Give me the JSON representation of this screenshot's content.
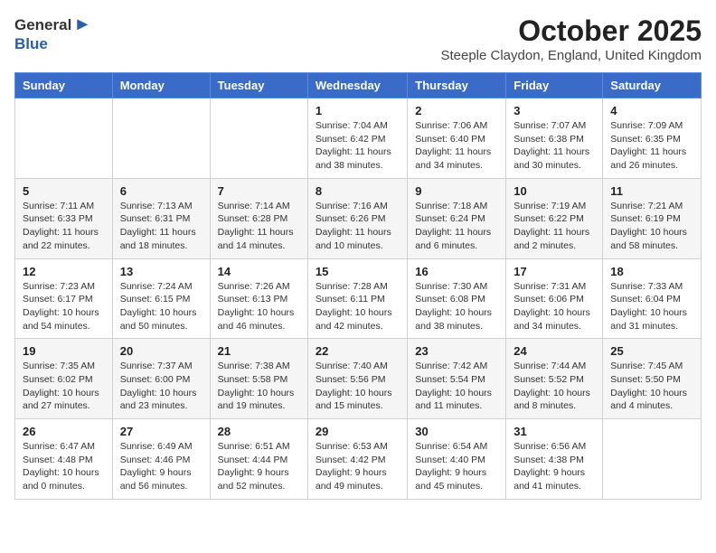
{
  "header": {
    "logo_general": "General",
    "logo_blue": "Blue",
    "month_title": "October 2025",
    "subtitle": "Steeple Claydon, England, United Kingdom"
  },
  "days_of_week": [
    "Sunday",
    "Monday",
    "Tuesday",
    "Wednesday",
    "Thursday",
    "Friday",
    "Saturday"
  ],
  "weeks": [
    [
      {
        "day": "",
        "info": ""
      },
      {
        "day": "",
        "info": ""
      },
      {
        "day": "",
        "info": ""
      },
      {
        "day": "1",
        "info": "Sunrise: 7:04 AM\nSunset: 6:42 PM\nDaylight: 11 hours and 38 minutes."
      },
      {
        "day": "2",
        "info": "Sunrise: 7:06 AM\nSunset: 6:40 PM\nDaylight: 11 hours and 34 minutes."
      },
      {
        "day": "3",
        "info": "Sunrise: 7:07 AM\nSunset: 6:38 PM\nDaylight: 11 hours and 30 minutes."
      },
      {
        "day": "4",
        "info": "Sunrise: 7:09 AM\nSunset: 6:35 PM\nDaylight: 11 hours and 26 minutes."
      }
    ],
    [
      {
        "day": "5",
        "info": "Sunrise: 7:11 AM\nSunset: 6:33 PM\nDaylight: 11 hours and 22 minutes."
      },
      {
        "day": "6",
        "info": "Sunrise: 7:13 AM\nSunset: 6:31 PM\nDaylight: 11 hours and 18 minutes."
      },
      {
        "day": "7",
        "info": "Sunrise: 7:14 AM\nSunset: 6:28 PM\nDaylight: 11 hours and 14 minutes."
      },
      {
        "day": "8",
        "info": "Sunrise: 7:16 AM\nSunset: 6:26 PM\nDaylight: 11 hours and 10 minutes."
      },
      {
        "day": "9",
        "info": "Sunrise: 7:18 AM\nSunset: 6:24 PM\nDaylight: 11 hours and 6 minutes."
      },
      {
        "day": "10",
        "info": "Sunrise: 7:19 AM\nSunset: 6:22 PM\nDaylight: 11 hours and 2 minutes."
      },
      {
        "day": "11",
        "info": "Sunrise: 7:21 AM\nSunset: 6:19 PM\nDaylight: 10 hours and 58 minutes."
      }
    ],
    [
      {
        "day": "12",
        "info": "Sunrise: 7:23 AM\nSunset: 6:17 PM\nDaylight: 10 hours and 54 minutes."
      },
      {
        "day": "13",
        "info": "Sunrise: 7:24 AM\nSunset: 6:15 PM\nDaylight: 10 hours and 50 minutes."
      },
      {
        "day": "14",
        "info": "Sunrise: 7:26 AM\nSunset: 6:13 PM\nDaylight: 10 hours and 46 minutes."
      },
      {
        "day": "15",
        "info": "Sunrise: 7:28 AM\nSunset: 6:11 PM\nDaylight: 10 hours and 42 minutes."
      },
      {
        "day": "16",
        "info": "Sunrise: 7:30 AM\nSunset: 6:08 PM\nDaylight: 10 hours and 38 minutes."
      },
      {
        "day": "17",
        "info": "Sunrise: 7:31 AM\nSunset: 6:06 PM\nDaylight: 10 hours and 34 minutes."
      },
      {
        "day": "18",
        "info": "Sunrise: 7:33 AM\nSunset: 6:04 PM\nDaylight: 10 hours and 31 minutes."
      }
    ],
    [
      {
        "day": "19",
        "info": "Sunrise: 7:35 AM\nSunset: 6:02 PM\nDaylight: 10 hours and 27 minutes."
      },
      {
        "day": "20",
        "info": "Sunrise: 7:37 AM\nSunset: 6:00 PM\nDaylight: 10 hours and 23 minutes."
      },
      {
        "day": "21",
        "info": "Sunrise: 7:38 AM\nSunset: 5:58 PM\nDaylight: 10 hours and 19 minutes."
      },
      {
        "day": "22",
        "info": "Sunrise: 7:40 AM\nSunset: 5:56 PM\nDaylight: 10 hours and 15 minutes."
      },
      {
        "day": "23",
        "info": "Sunrise: 7:42 AM\nSunset: 5:54 PM\nDaylight: 10 hours and 11 minutes."
      },
      {
        "day": "24",
        "info": "Sunrise: 7:44 AM\nSunset: 5:52 PM\nDaylight: 10 hours and 8 minutes."
      },
      {
        "day": "25",
        "info": "Sunrise: 7:45 AM\nSunset: 5:50 PM\nDaylight: 10 hours and 4 minutes."
      }
    ],
    [
      {
        "day": "26",
        "info": "Sunrise: 6:47 AM\nSunset: 4:48 PM\nDaylight: 10 hours and 0 minutes."
      },
      {
        "day": "27",
        "info": "Sunrise: 6:49 AM\nSunset: 4:46 PM\nDaylight: 9 hours and 56 minutes."
      },
      {
        "day": "28",
        "info": "Sunrise: 6:51 AM\nSunset: 4:44 PM\nDaylight: 9 hours and 52 minutes."
      },
      {
        "day": "29",
        "info": "Sunrise: 6:53 AM\nSunset: 4:42 PM\nDaylight: 9 hours and 49 minutes."
      },
      {
        "day": "30",
        "info": "Sunrise: 6:54 AM\nSunset: 4:40 PM\nDaylight: 9 hours and 45 minutes."
      },
      {
        "day": "31",
        "info": "Sunrise: 6:56 AM\nSunset: 4:38 PM\nDaylight: 9 hours and 41 minutes."
      },
      {
        "day": "",
        "info": ""
      }
    ]
  ]
}
